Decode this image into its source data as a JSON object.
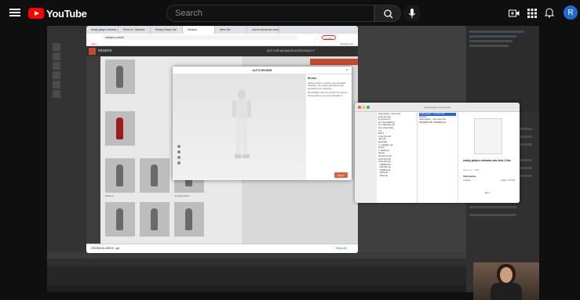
{
  "youtube": {
    "brand": "YouTube",
    "search_placeholder": "Search",
    "avatar_initial": "R"
  },
  "browser": {
    "tabs": [
      "ready player mixamo...",
      "Photo 8 - Mixamo",
      "Ready Player Me",
      "Mixamo",
      "New Tab",
      "how to blend two anim..."
    ],
    "url": "mixamo.com/#/",
    "update_label": "Update",
    "bookmarks": "Apps",
    "reading_list": "Reading List"
  },
  "mixamo": {
    "logo": "mixamo",
    "header_right": "ADY FOR MIXAMO/PLAYER.READY F",
    "actions": [
      "",
      "RESET POSE",
      "UPLOAD CHARACTER",
      "FIND ANIMATIONS"
    ],
    "thumb_labels": [
      "Mixamo",
      "",
      "Jumping Down"
    ],
    "download_item": "2E54B4D6-2B0D0...glb",
    "show_all": "Show All"
  },
  "modal": {
    "title": "AUTO-RIGGER",
    "info_title": "Review",
    "info_body": "Please check to confirm your uploaded character, then apply animations and download your character.",
    "info_body2": "Not satisfied with the results? Go back to the beginning to get new alterations.",
    "next_label": "NEXT",
    "close": "×"
  },
  "finder": {
    "title": "ready-player-mixamo-test",
    "col2_items": [
      "ready-player...ixamo-test",
      "st the first.pdf",
      "ill mixamo.zip",
      "ter 1 Spreadsheet",
      "ter 2 Narrative.pdf",
      "ister cheat sheet",
      "st 1...",
      "ENT 1...",
      "of the first.pdf",
      "nder.pdf",
      "file Folder",
      "Y_1102000..pdf",
      "file.pdf",
      "T 12345.pdf",
      "ble.pdf",
      "file 100 01.pdf",
      "of the first.pdf",
      "of the first.pdf",
      "...054893.921",
      "...042-001.zip",
      "...054893.pdf",
      "...0001.pdf",
      "...0001.zip"
    ],
    "col3_items": [
      "ready-player-...ne-test-1.fbx",
      "textures",
      "ready-player-...ure-1-dmm.fbx",
      "2E54B4D6-2B...B4D6B9A.glb"
    ],
    "col3_selected": 0,
    "file_name": "ready-player-mixamo-nav-test-1.fbx",
    "file_meta": "Document - 2 MB",
    "info_head": "Information",
    "created_label": "Created",
    "created_value": "Today, 7:59 PM",
    "more": "More..."
  }
}
